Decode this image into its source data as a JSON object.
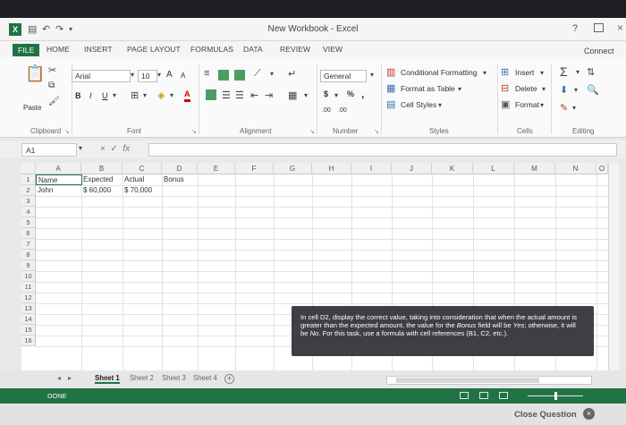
{
  "window": {
    "title": "New Workbook - Excel",
    "help": "?",
    "logo": "X",
    "close": "×"
  },
  "ribbon_tabs": [
    "FILE",
    "HOME",
    "INSERT",
    "PAGE LAYOUT",
    "FORMULAS",
    "DATA",
    "REVIEW",
    "VIEW"
  ],
  "connect": "Connect",
  "clipboard": {
    "paste": "Paste",
    "label": "Clipboard"
  },
  "font": {
    "name": "Arial",
    "size": "10",
    "bold": "B",
    "italic": "I",
    "underline": "U",
    "label": "Font",
    "grow": "A",
    "shrink": "A",
    "color": "A"
  },
  "alignment": {
    "label": "Alignment"
  },
  "number": {
    "format": "General",
    "currency": "$",
    "percent": "%",
    "comma": ",",
    "label": "Number",
    "inc_decimal": ".00",
    "dec_decimal": ".00"
  },
  "styles": {
    "conditional": "Conditional Formatting",
    "format_table": "Format as Table",
    "cell_styles": "Cell Styles",
    "label": "Styles"
  },
  "cells": {
    "insert": "Insert",
    "delete": "Delete",
    "format": "Format",
    "label": "Cells"
  },
  "editing": {
    "label": "Editing"
  },
  "formula_bar": {
    "name_box": "A1",
    "cancel": "×",
    "enter": "✓",
    "fx": "fx"
  },
  "columns": [
    "A",
    "B",
    "C",
    "D",
    "E",
    "F",
    "G",
    "H",
    "I",
    "J",
    "K",
    "L",
    "M",
    "N",
    "O"
  ],
  "rows": [
    "1",
    "2",
    "3",
    "4",
    "5",
    "6",
    "7",
    "8",
    "9",
    "10",
    "11",
    "12",
    "13",
    "14",
    "15",
    "16"
  ],
  "cells_data": {
    "a1": "Name",
    "b1": "Expected",
    "c1": "Actual",
    "d1": "Bonus",
    "a2": "John",
    "b2": "$ 60,000",
    "c2": "$ 70,000"
  },
  "instruction": {
    "part1": "In cell D2, display the correct value, taking into consideration that when the actual amount is greater than the expected amount, the value for the ",
    "bonus": "Bonus",
    "part2": " field will be ",
    "yes": "Yes",
    "part3": "; otherwise, it will be ",
    "no": "No",
    "part4": ". For this task, use a formula with cell references (B1, C2, etc.)."
  },
  "sheets": [
    "Sheet 1",
    "Sheet 2",
    "Sheet 3",
    "Sheet 4"
  ],
  "add_sheet": "+",
  "status": "DONE",
  "close_question": "Close Question",
  "close_question_icon": "×",
  "colors": {
    "excel_green": "#217346",
    "instruction_bg": "#3d3f44"
  }
}
